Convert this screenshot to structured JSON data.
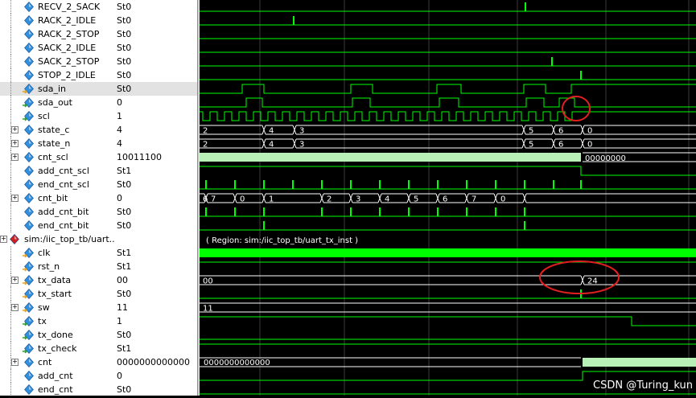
{
  "signals": [
    {
      "name": "RECV_2_SACK",
      "value": "St0",
      "type": "bit",
      "icon": "signal-icon"
    },
    {
      "name": "RACK_2_IDLE",
      "value": "St0",
      "type": "bit",
      "icon": "signal-icon"
    },
    {
      "name": "RACK_2_STOP",
      "value": "St0",
      "type": "bit",
      "icon": "signal-icon"
    },
    {
      "name": "SACK_2_IDLE",
      "value": "St0",
      "type": "bit",
      "icon": "signal-icon"
    },
    {
      "name": "SACK_2_STOP",
      "value": "St0",
      "type": "bit",
      "icon": "signal-icon"
    },
    {
      "name": "STOP_2_IDLE",
      "value": "St0",
      "type": "bit",
      "icon": "signal-icon"
    },
    {
      "name": "sda_in",
      "value": "St0",
      "type": "bit",
      "icon": "input-signal-icon",
      "selected": true
    },
    {
      "name": "sda_out",
      "value": "0",
      "type": "bit",
      "icon": "output-signal-icon"
    },
    {
      "name": "scl",
      "value": "1",
      "type": "bit",
      "icon": "output-signal-icon"
    },
    {
      "name": "state_c",
      "value": "4",
      "type": "bus",
      "icon": "signal-icon",
      "expandable": true
    },
    {
      "name": "state_n",
      "value": "4",
      "type": "bus",
      "icon": "signal-icon",
      "expandable": true
    },
    {
      "name": "cnt_scl",
      "value": "10011100",
      "type": "bus",
      "icon": "signal-icon",
      "expandable": true
    },
    {
      "name": "add_cnt_scl",
      "value": "St1",
      "type": "bit",
      "icon": "signal-icon"
    },
    {
      "name": "end_cnt_scl",
      "value": "St0",
      "type": "bit",
      "icon": "signal-icon"
    },
    {
      "name": "cnt_bit",
      "value": "0",
      "type": "bus",
      "icon": "signal-icon",
      "expandable": true
    },
    {
      "name": "add_cnt_bit",
      "value": "St0",
      "type": "bit",
      "icon": "signal-icon"
    },
    {
      "name": "end_cnt_bit",
      "value": "St0",
      "type": "bit",
      "icon": "signal-icon"
    },
    {
      "name": "sim:/iic_top_tb/uart...",
      "value": "",
      "type": "group",
      "icon": "instance-icon",
      "expandable": true
    },
    {
      "name": "clk",
      "value": "St1",
      "type": "bit",
      "icon": "input-signal-icon"
    },
    {
      "name": "rst_n",
      "value": "St1",
      "type": "bit",
      "icon": "input-signal-icon"
    },
    {
      "name": "tx_data",
      "value": "00",
      "type": "bus",
      "icon": "input-signal-icon",
      "expandable": true
    },
    {
      "name": "tx_start",
      "value": "St0",
      "type": "bit",
      "icon": "input-signal-icon"
    },
    {
      "name": "sw",
      "value": "11",
      "type": "bus",
      "icon": "input-signal-icon",
      "expandable": true
    },
    {
      "name": "tx",
      "value": "1",
      "type": "bit",
      "icon": "output-signal-icon"
    },
    {
      "name": "tx_done",
      "value": "St0",
      "type": "bit",
      "icon": "output-signal-icon"
    },
    {
      "name": "tx_check",
      "value": "St1",
      "type": "bit",
      "icon": "output-signal-icon"
    },
    {
      "name": "cnt",
      "value": "0000000000000",
      "type": "bus",
      "icon": "signal-icon",
      "expandable": true
    },
    {
      "name": "add_cnt",
      "value": "0",
      "type": "bit",
      "icon": "signal-icon"
    },
    {
      "name": "end_cnt",
      "value": "St0",
      "type": "bit",
      "icon": "signal-icon"
    }
  ],
  "bus_labels": {
    "state_c": [
      "2",
      "4",
      "3",
      "5",
      "6",
      "0"
    ],
    "state_n": [
      "2",
      "4",
      "3",
      "5",
      "6",
      "0"
    ],
    "cnt_scl": [
      "00000000"
    ],
    "cnt_bit": [
      "6",
      "7",
      "0",
      "1",
      "2",
      "3",
      "4",
      "5",
      "6",
      "7",
      "0"
    ],
    "tx_data": [
      "00",
      "24"
    ],
    "sw": [
      "11"
    ],
    "cnt": [
      "0000000000000"
    ]
  },
  "region_label": "( Region: sim:/iic_top_tb/uart_tx_inst )",
  "watermark": "CSDN @Turing_kun",
  "colors": {
    "wave": "#00ff00",
    "annotation": "#e02020",
    "bus_fill": "#b8f0b8",
    "selected_row": "#e2e2e2"
  }
}
